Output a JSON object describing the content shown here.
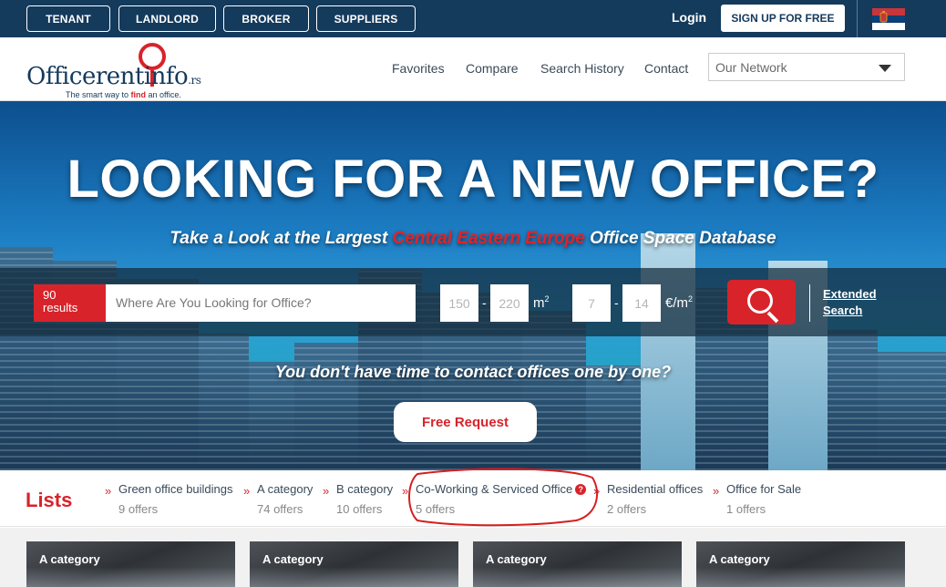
{
  "topbar": {
    "roles": [
      "TENANT",
      "LANDLORD",
      "BROKER",
      "SUPPLIERS"
    ],
    "login_label": "Login",
    "signup_label": "SIGN UP FOR FREE",
    "flag_icon": "serbia-flag-icon"
  },
  "header": {
    "logo": {
      "brand": "Officerent",
      "brand_suffix": "info",
      "tld": ".rs",
      "tagline_before": "The smart way to ",
      "tagline_find": "find",
      "tagline_after": " an office."
    },
    "nav": [
      "Favorites",
      "Compare",
      "Search History",
      "Contact"
    ],
    "network_select": {
      "value": "Our Network"
    }
  },
  "hero": {
    "title": "LOOKING FOR A NEW OFFICE?",
    "subtitle_before": "Take a Look at the Largest ",
    "subtitle_highlight": "Central Eastern Europe",
    "subtitle_after": " Office Space Database",
    "search": {
      "results_count": "90",
      "results_label": "results",
      "placeholder": "Where Are You Looking for Office?",
      "area_min": "150",
      "area_max": "220",
      "area_unit": "m",
      "area_unit_sup": "2",
      "price_min": "7",
      "price_max": "14",
      "price_unit": "€/m",
      "price_unit_sup": "2",
      "extended_line1": "Extended",
      "extended_line2": "Search"
    },
    "question": "You don't have time to contact offices one by one?",
    "free_request_label": "Free Request"
  },
  "lists": {
    "title": "Lists",
    "items": [
      {
        "name": "Green office buildings",
        "count": "9 offers"
      },
      {
        "name": "A category",
        "count": "74 offers"
      },
      {
        "name": "B category",
        "count": "10 offers"
      },
      {
        "name": "Co-Working & Serviced Office",
        "count": "5 offers",
        "help_icon": "question-icon",
        "help_glyph": "?"
      },
      {
        "name": "Residential offices",
        "count": "2 offers"
      },
      {
        "name": "Office for Sale",
        "count": "1 offers"
      }
    ],
    "chevron": "»"
  },
  "cards": [
    {
      "category": "A category"
    },
    {
      "category": "A category"
    },
    {
      "category": "A category"
    },
    {
      "category": "A category"
    }
  ],
  "colors": {
    "brand_navy": "#143a5c",
    "brand_red": "#d8232a",
    "annotation_red": "#d41f1f"
  }
}
